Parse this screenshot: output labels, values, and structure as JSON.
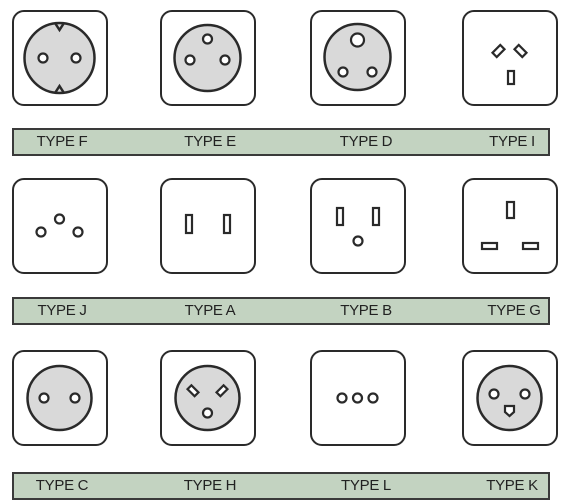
{
  "rows": [
    {
      "labels": [
        "TYPE F",
        "TYPE E",
        "TYPE D",
        "TYPE I"
      ]
    },
    {
      "labels": [
        "TYPE J",
        "TYPE A",
        "TYPE B",
        "TYPE G"
      ]
    },
    {
      "labels": [
        "TYPE C",
        "TYPE H",
        "TYPE L",
        "TYPE K"
      ]
    }
  ],
  "colors": {
    "band_fill": "#c3d3c1",
    "outline": "#2a2a2a",
    "socket_face": "#d9d9d9"
  }
}
